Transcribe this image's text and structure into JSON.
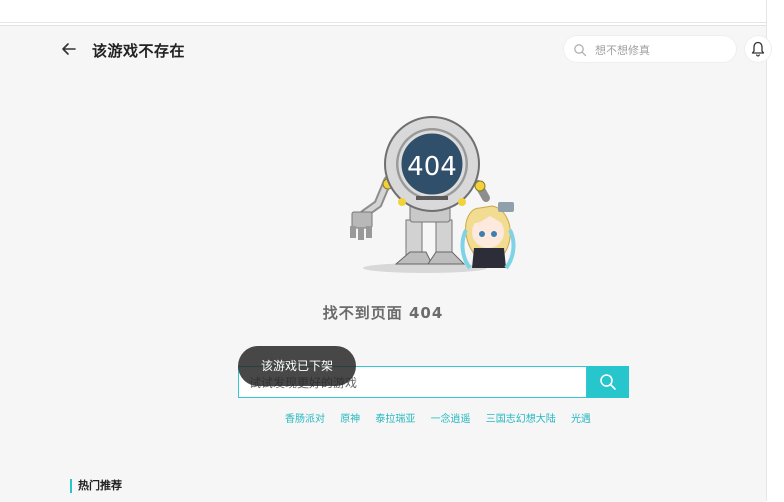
{
  "header": {
    "title": "该游戏不存在",
    "search_placeholder": "想不想修真"
  },
  "error": {
    "image_text": "404",
    "message": "找不到页面 404"
  },
  "search": {
    "placeholder": "试试发现更好的游戏"
  },
  "hot_links": [
    "香肠派对",
    "原神",
    "泰拉瑞亚",
    "一念逍遥",
    "三国志幻想大陆",
    "光遇"
  ],
  "toast": "该游戏已下架",
  "section": {
    "title": "热门推荐"
  },
  "colors": {
    "accent": "#26c6cc",
    "background": "#f6f6f6",
    "link": "#26b8c0"
  }
}
